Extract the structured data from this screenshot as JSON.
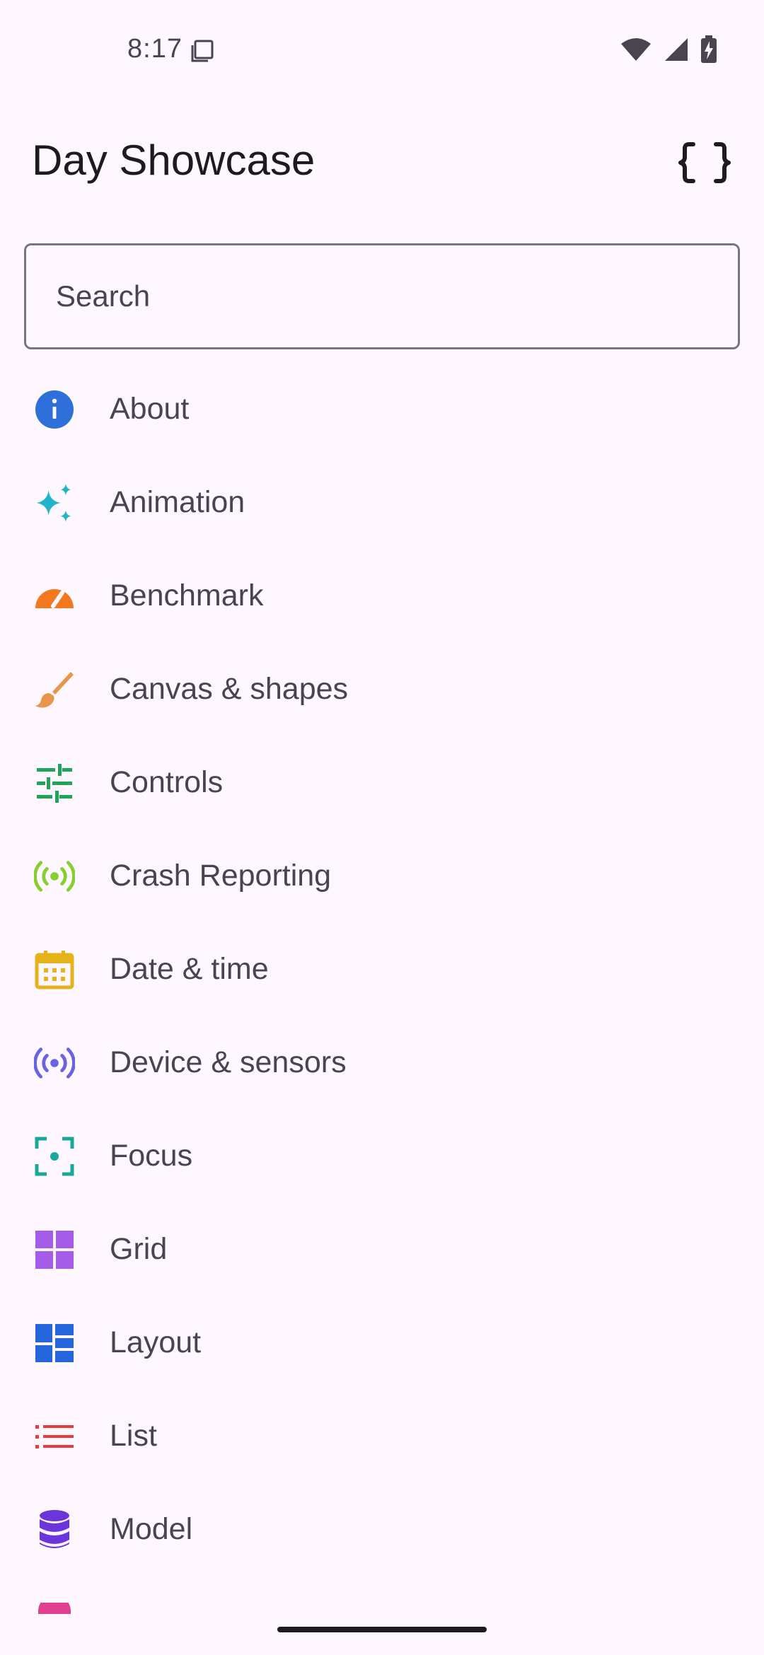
{
  "status_bar": {
    "time": "8:17",
    "icons": [
      "screen-record-icon",
      "wifi-icon",
      "signal-icon",
      "battery-charging-icon"
    ]
  },
  "app_bar": {
    "title": "Day Showcase",
    "action_icon": "code-braces-icon"
  },
  "search": {
    "placeholder": "Search",
    "value": ""
  },
  "colors": {
    "background": "#fef7ff",
    "about": "#2f6fd9",
    "animation": "#1fb5c9",
    "benchmark": "#f2781f",
    "canvas": "#e9954a",
    "controls": "#1ea55a",
    "crash": "#86cf2c",
    "date": "#e5b21a",
    "device": "#6a63e0",
    "focus": "#15a89b",
    "grid": "#a35be8",
    "layout": "#2566dc",
    "list": "#ea3b3b",
    "model": "#6b35d9",
    "next": "#e0408f"
  },
  "nav": {
    "items": [
      {
        "label": "About",
        "icon": "info-icon"
      },
      {
        "label": "Animation",
        "icon": "sparkle-icon"
      },
      {
        "label": "Benchmark",
        "icon": "speedometer-icon"
      },
      {
        "label": "Canvas & shapes",
        "icon": "brush-icon"
      },
      {
        "label": "Controls",
        "icon": "tune-sliders-icon"
      },
      {
        "label": "Crash Reporting",
        "icon": "broadcast-icon"
      },
      {
        "label": "Date & time",
        "icon": "calendar-icon"
      },
      {
        "label": "Device & sensors",
        "icon": "sensors-icon"
      },
      {
        "label": "Focus",
        "icon": "focus-frame-icon"
      },
      {
        "label": "Grid",
        "icon": "grid-icon"
      },
      {
        "label": "Layout",
        "icon": "layout-icon"
      },
      {
        "label": "List",
        "icon": "list-icon"
      },
      {
        "label": "Model",
        "icon": "database-icon"
      },
      {
        "label": "",
        "icon": "partial-next-icon"
      }
    ]
  }
}
